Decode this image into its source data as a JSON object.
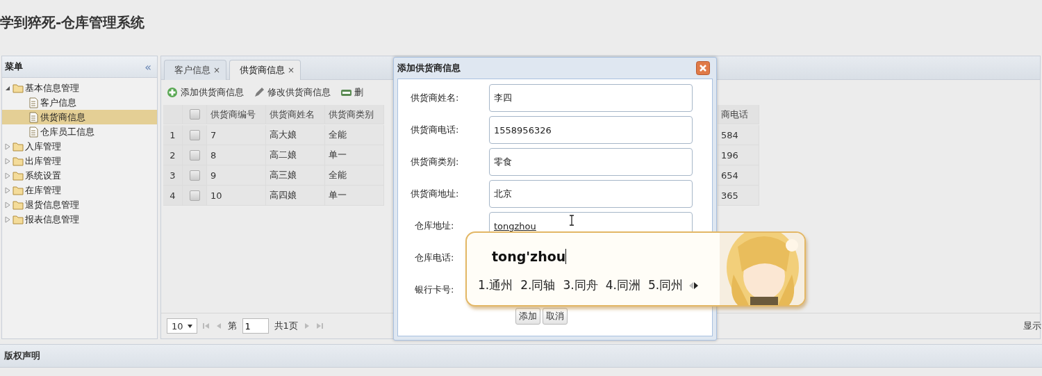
{
  "app": {
    "title": "学到猝死-仓库管理系统"
  },
  "menu": {
    "title": "菜单",
    "collapse_glyph": "«",
    "items": [
      {
        "label": "基本信息管理",
        "expanded": true,
        "selected": false,
        "children": [
          {
            "label": "客户信息",
            "selected": false
          },
          {
            "label": "供货商信息",
            "selected": true
          },
          {
            "label": "仓库员工信息",
            "selected": false
          }
        ]
      },
      {
        "label": "入库管理",
        "expanded": false,
        "selected": false
      },
      {
        "label": "出库管理",
        "expanded": false,
        "selected": false
      },
      {
        "label": "系统设置",
        "expanded": false,
        "selected": false
      },
      {
        "label": "在库管理",
        "expanded": false,
        "selected": false
      },
      {
        "label": "退货信息管理",
        "expanded": false,
        "selected": false
      },
      {
        "label": "报表信息管理",
        "expanded": false,
        "selected": false
      }
    ]
  },
  "tabs": [
    {
      "label": "客户信息",
      "close": "×",
      "selected": false
    },
    {
      "label": "供货商信息",
      "close": "×",
      "selected": true
    }
  ],
  "toolbar": [
    {
      "label": "添加供货商信息",
      "kind": "add"
    },
    {
      "label": "修改供货商信息",
      "kind": "edit"
    },
    {
      "label": "删",
      "kind": "delete"
    }
  ],
  "table": {
    "columns": [
      "供货商编号",
      "供货商姓名",
      "供货商类别",
      "商电话"
    ],
    "header_checked": false,
    "rows": [
      {
        "number": "1",
        "checked": false,
        "cells": [
          "7",
          "高大娘",
          "全能",
          "584"
        ]
      },
      {
        "number": "2",
        "checked": false,
        "cells": [
          "8",
          "高二娘",
          "单一",
          "196"
        ]
      },
      {
        "number": "3",
        "checked": false,
        "cells": [
          "9",
          "高三娘",
          "全能",
          "654"
        ]
      },
      {
        "number": "4",
        "checked": false,
        "cells": [
          "10",
          "高四娘",
          "单一",
          "365"
        ]
      }
    ]
  },
  "pager": {
    "page_size": "10",
    "page_label": "第",
    "page": "1",
    "total": "共1页",
    "display": "显示"
  },
  "footer": {
    "title": "版权声明"
  },
  "dialog": {
    "title": "添加供货商信息",
    "fields": [
      {
        "label": "供货商姓名:",
        "value": "李四",
        "composing": false
      },
      {
        "label": "供货商电话:",
        "value": "1558956326",
        "composing": false
      },
      {
        "label": "供货商类别:",
        "value": "零食",
        "composing": false
      },
      {
        "label": "供货商地址:",
        "value": "北京",
        "composing": false
      },
      {
        "label": "仓库地址:",
        "value": "tongzhou",
        "composing": true
      },
      {
        "label": "仓库电话:"
      },
      {
        "label": "银行卡号:"
      }
    ],
    "buttons": [
      "添加",
      "取消"
    ]
  },
  "ime": {
    "composition": "tong'zhou",
    "candidates": [
      "1.通州",
      "2.同轴",
      "3.同舟",
      "4.同洲",
      "5.同州"
    ]
  }
}
